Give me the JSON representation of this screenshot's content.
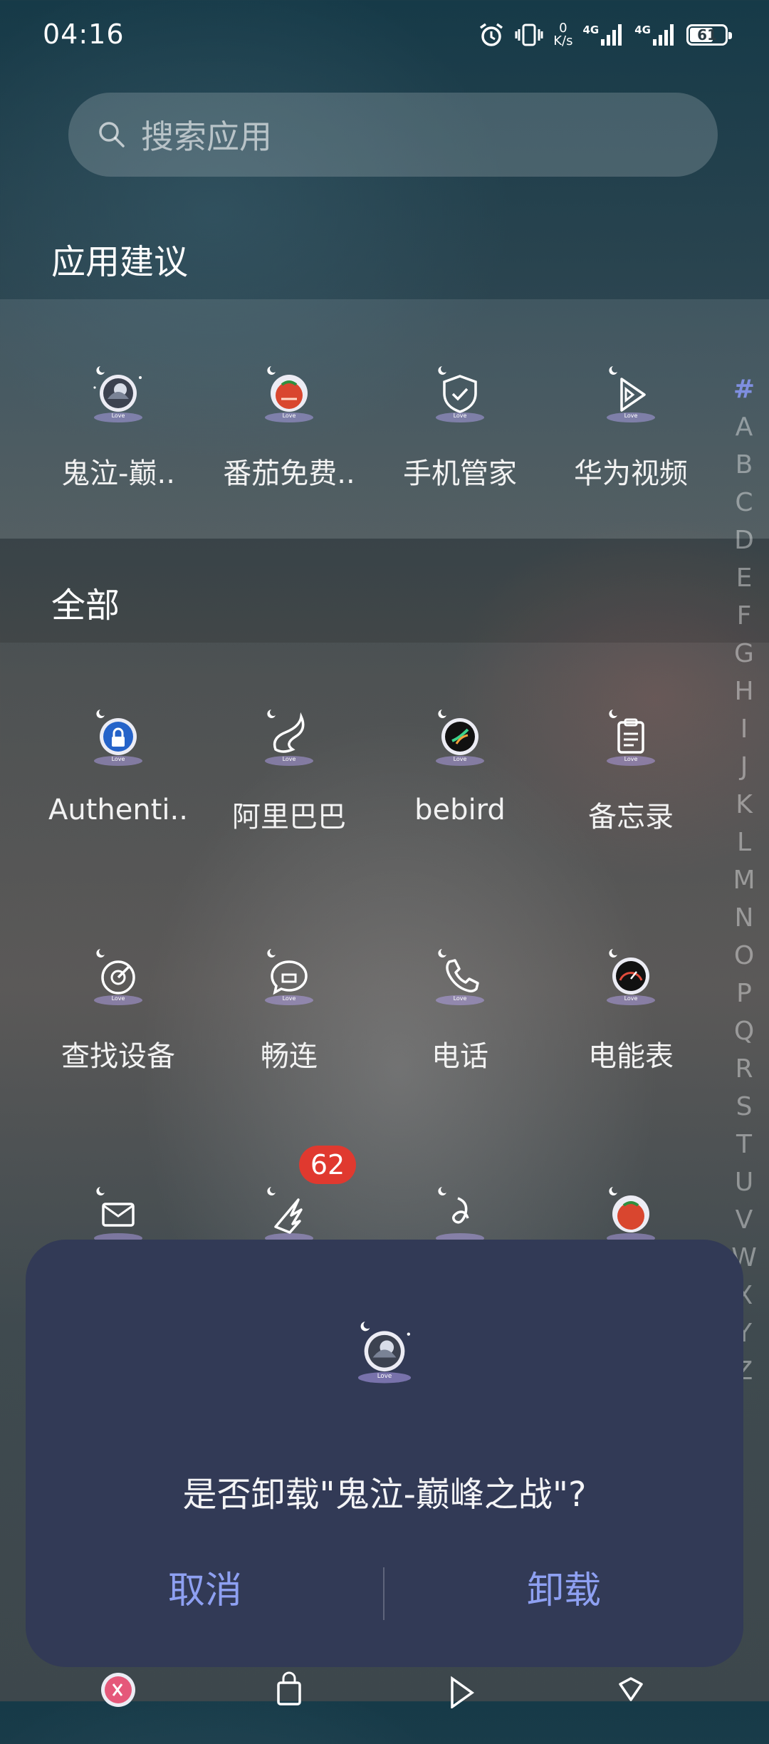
{
  "status_bar": {
    "time": "04:16",
    "net_speed_value": "0",
    "net_speed_unit": "K/s",
    "signal1_label": "4G",
    "signal2_label": "4G",
    "battery": "61"
  },
  "search": {
    "placeholder": "搜索应用"
  },
  "sections": {
    "suggested_title": "应用建议",
    "all_title": "全部"
  },
  "suggested_apps": [
    {
      "label": "鬼泣-巅..",
      "icon": "game-avatar-icon"
    },
    {
      "label": "番茄免费..",
      "icon": "tomato-icon"
    },
    {
      "label": "手机管家",
      "icon": "shield-check-icon"
    },
    {
      "label": "华为视频",
      "icon": "play-icon"
    }
  ],
  "all_apps": [
    {
      "label": "Authenti..",
      "icon": "lock-icon"
    },
    {
      "label": "阿里巴巴",
      "icon": "alibaba-icon"
    },
    {
      "label": "bebird",
      "icon": "bird-icon"
    },
    {
      "label": "备忘录",
      "icon": "clipboard-icon"
    },
    {
      "label": "查找设备",
      "icon": "radar-icon"
    },
    {
      "label": "畅连",
      "icon": "chat-icon"
    },
    {
      "label": "电话",
      "icon": "phone-icon"
    },
    {
      "label": "电能表",
      "icon": "meter-icon"
    }
  ],
  "partial_row_icons": [
    "mail-icon",
    "wing-icon",
    "music-icon",
    "tomato-icon"
  ],
  "bottom_row_icons": [
    "video-icon",
    "bag-icon",
    "play-icon",
    "heart-icon"
  ],
  "badge": {
    "count": "62"
  },
  "alphabet_index": [
    "#",
    "A",
    "B",
    "C",
    "D",
    "E",
    "F",
    "G",
    "H",
    "I",
    "J",
    "K",
    "L",
    "M",
    "N",
    "O",
    "P",
    "Q",
    "R",
    "S",
    "T",
    "U",
    "V",
    "W",
    "X",
    "Y",
    "Z"
  ],
  "dialog": {
    "message": "是否卸载\"鬼泣-巅峰之战\"?",
    "cancel_label": "取消",
    "uninstall_label": "卸载"
  },
  "colors": {
    "dialog_bg": "#323a56",
    "dialog_button": "#8ea0f2",
    "badge": "#e0392f",
    "index_active": "#7f8fe0"
  }
}
